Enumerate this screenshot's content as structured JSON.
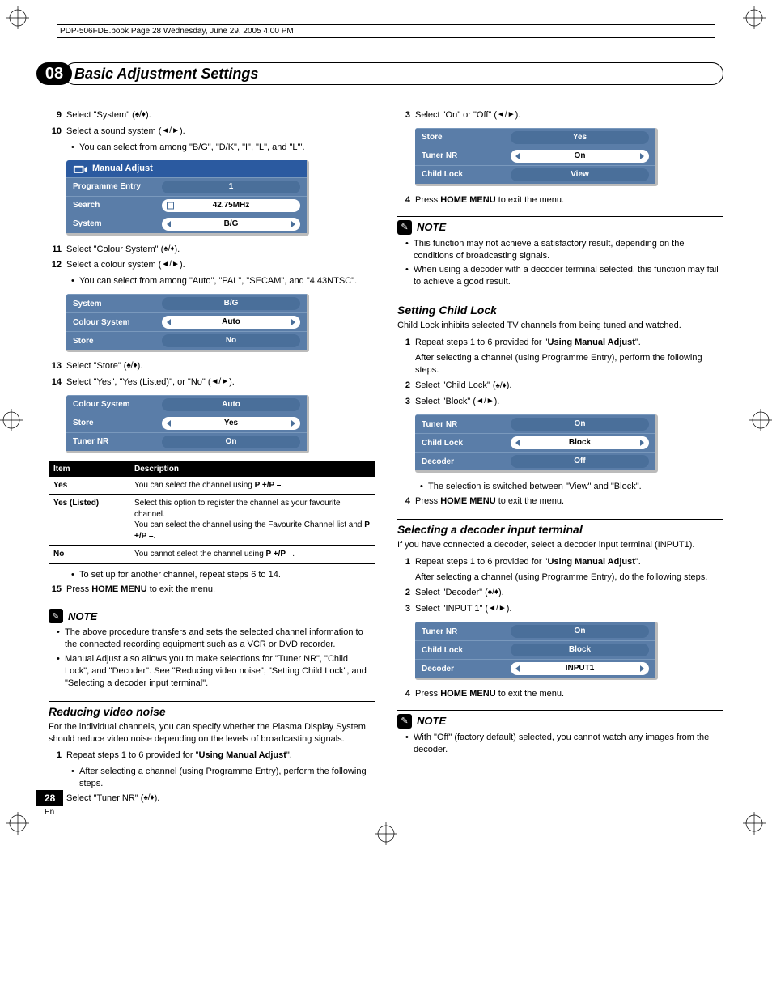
{
  "meta_line": "PDP-506FDE.book  Page 28  Wednesday, June 29, 2005  4:00 PM",
  "chapter": {
    "num": "08",
    "title": "Basic Adjustment Settings"
  },
  "col1": {
    "steps_a": [
      {
        "n": "9",
        "text": "Select \"System\" (",
        "arrows": "ud",
        "tail": ")."
      },
      {
        "n": "10",
        "text": "Select a sound system (",
        "arrows": "lr",
        "tail": ")."
      }
    ],
    "bullet_a": "You can select from among \"B/G\", \"D/K\", \"I\", \"L\", and \"L'\".",
    "osd1": {
      "title": "Manual Adjust",
      "rows": [
        {
          "label": "Programme Entry",
          "value": "1",
          "style": "blue"
        },
        {
          "label": "Search",
          "value": "42.75MHz",
          "style": "sq"
        },
        {
          "label": "System",
          "value": "B/G",
          "style": "arrows"
        }
      ]
    },
    "steps_b": [
      {
        "n": "11",
        "text": "Select \"Colour System\" (",
        "arrows": "ud",
        "tail": ")."
      },
      {
        "n": "12",
        "text": "Select a colour system (",
        "arrows": "lr",
        "tail": ")."
      }
    ],
    "bullet_b": "You can select from among \"Auto\", \"PAL\", \"SECAM\", and \"4.43NTSC\".",
    "osd2": {
      "rows": [
        {
          "label": "System",
          "value": "B/G",
          "style": "blue"
        },
        {
          "label": "Colour System",
          "value": "Auto",
          "style": "arrows"
        },
        {
          "label": "Store",
          "value": "No",
          "style": "blue"
        }
      ]
    },
    "steps_c": [
      {
        "n": "13",
        "text": "Select \"Store\" (",
        "arrows": "ud",
        "tail": ")."
      },
      {
        "n": "14",
        "text": "Select \"Yes\", \"Yes (Listed)\", or \"No\" (",
        "arrows": "lr",
        "tail": ")."
      }
    ],
    "osd3": {
      "rows": [
        {
          "label": "Colour System",
          "value": "Auto",
          "style": "blue"
        },
        {
          "label": "Store",
          "value": "Yes",
          "style": "arrows"
        },
        {
          "label": "Tuner NR",
          "value": "On",
          "style": "blue"
        }
      ]
    },
    "def_table": {
      "headers": [
        "Item",
        "Description"
      ],
      "rows": [
        {
          "item": "Yes",
          "desc_pre": "You can select the channel using ",
          "desc_bold": "P +/P –",
          "desc_post": "."
        },
        {
          "item": "Yes (Listed)",
          "desc_pre": "Select this option to register the channel as your favourite channel.\nYou can select the channel using the Favourite Channel list and ",
          "desc_bold": "P +/P –",
          "desc_post": "."
        },
        {
          "item": "No",
          "desc_pre": "You cannot select the channel using ",
          "desc_bold": "P +/P –",
          "desc_post": "."
        }
      ]
    },
    "bullet_c": "To set up for another channel, repeat steps 6 to 14.",
    "step15_pre": "Press ",
    "step15_bold": "HOME MENU",
    "step15_post": " to exit the menu.",
    "note_title": "NOTE",
    "note_bullets": [
      "The above procedure transfers and sets the selected channel information to the connected recording equipment such as a VCR or DVD recorder.",
      "Manual Adjust also allows you to make selections for \"Tuner NR\", \"Child Lock\", and \"Decoder\". See \"Reducing video noise\", \"Setting Child Lock\", and \"Selecting a decoder input terminal\"."
    ],
    "reducing": {
      "title": "Reducing video noise",
      "intro": "For the individual channels, you can specify whether the Plasma Display System should reduce video noise depending on the levels of broadcasting signals.",
      "step1_pre": "Repeat steps 1 to 6 provided for \"",
      "step1_bold": "Using Manual Adjust",
      "step1_post": "\".",
      "step1_bullet": "After selecting a channel (using Programme Entry), perform the following steps.",
      "step2_pre": "Select \"Tuner NR\" (",
      "step2_post": ")."
    }
  },
  "col2": {
    "step3_pre": "Select \"On\" or \"Off\" (",
    "step3_post": ").",
    "osd4": {
      "rows": [
        {
          "label": "Store",
          "value": "Yes",
          "style": "blue"
        },
        {
          "label": "Tuner NR",
          "value": "On",
          "style": "arrows"
        },
        {
          "label": "Child Lock",
          "value": "View",
          "style": "blue"
        }
      ]
    },
    "step4_pre": "Press ",
    "step4_bold": "HOME MENU",
    "step4_post": " to exit the menu.",
    "note_title": "NOTE",
    "note_bullets": [
      "This function may not achieve a satisfactory result, depending on the conditions of broadcasting signals.",
      "When using a decoder with a decoder terminal selected, this function may fail to achieve a good result."
    ],
    "childlock": {
      "title": "Setting Child Lock",
      "intro": "Child Lock inhibits selected TV channels from being tuned and watched.",
      "step1_pre": "Repeat steps 1 to 6 provided for \"",
      "step1_bold": "Using Manual Adjust",
      "step1_post": "\".",
      "step1_sub": "After selecting a channel (using Programme Entry), perform the following steps.",
      "step2": "Select \"Child Lock\" (",
      "step2_post": ").",
      "step3": "Select \"Block\" (",
      "step3_post": ").",
      "osd5": {
        "rows": [
          {
            "label": "Tuner NR",
            "value": "On",
            "style": "blue"
          },
          {
            "label": "Child Lock",
            "value": "Block",
            "style": "arrows"
          },
          {
            "label": "Decoder",
            "value": "Off",
            "style": "blue"
          }
        ]
      },
      "bullet": "The selection is switched between \"View\" and \"Block\".",
      "step4_pre": "Press ",
      "step4_bold": "HOME MENU",
      "step4_post": " to exit the menu."
    },
    "decoder": {
      "title": "Selecting a decoder input terminal",
      "intro": "If you have connected a decoder, select a decoder input terminal (INPUT1).",
      "step1_pre": "Repeat steps 1 to 6 provided for \"",
      "step1_bold": "Using Manual Adjust",
      "step1_post": "\".",
      "step1_sub": "After selecting a channel (using Programme Entry), do the following steps.",
      "step2": "Select \"Decoder\" (",
      "step2_post": ").",
      "step3": "Select \"INPUT 1\" (",
      "step3_post": ").",
      "osd6": {
        "rows": [
          {
            "label": "Tuner NR",
            "value": "On",
            "style": "blue"
          },
          {
            "label": "Child Lock",
            "value": "Block",
            "style": "blue"
          },
          {
            "label": "Decoder",
            "value": "INPUT1",
            "style": "arrows"
          }
        ]
      },
      "step4_pre": "Press ",
      "step4_bold": "HOME MENU",
      "step4_post": " to exit the menu.",
      "note_title": "NOTE",
      "note_bullet": "With \"Off\" (factory default) selected, you cannot watch any images from the decoder."
    }
  },
  "footer": {
    "page": "28",
    "lang": "En"
  }
}
